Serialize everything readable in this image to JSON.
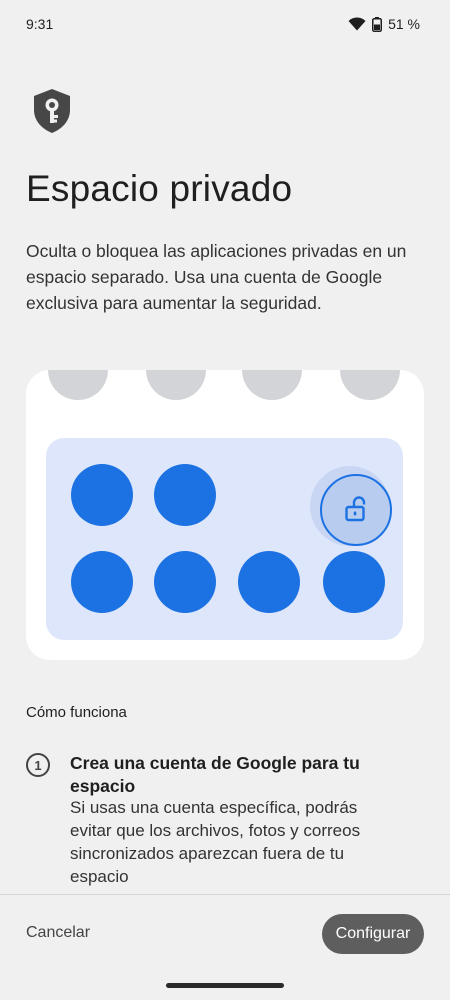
{
  "status_bar": {
    "time": "9:31",
    "battery_percent": "51 %",
    "icons": [
      "wifi-icon",
      "battery-icon"
    ]
  },
  "header": {
    "icon": "shield-key-icon",
    "title": "Espacio privado",
    "description": "Oculta o bloquea las aplicaciones privadas en un espacio separado. Usa una cuenta de Google exclusiva para aumentar la seguridad."
  },
  "illustration": {
    "icon": "unlock-icon",
    "colors": {
      "grey_app": "#d3d4d7",
      "private_area": "#dde6fa",
      "private_app": "#1d72e3"
    }
  },
  "how_it_works": {
    "heading": "Cómo funciona",
    "steps": [
      {
        "number": "1",
        "title": "Crea una cuenta de Google para tu espacio",
        "body": "Si usas una cuenta específica, podrás evitar que los archivos, fotos y correos sincronizados aparezcan fuera de tu espacio"
      }
    ]
  },
  "footer": {
    "cancel_label": "Cancelar",
    "configure_label": "Configurar"
  }
}
